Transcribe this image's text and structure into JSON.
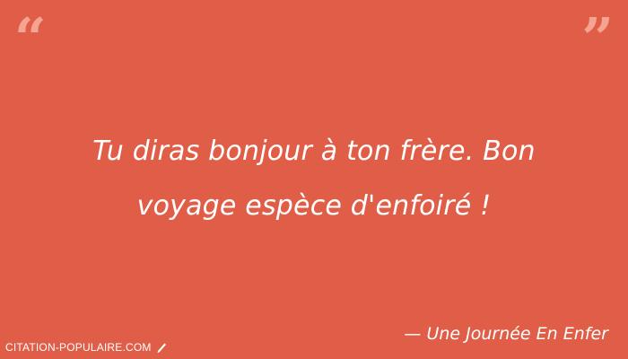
{
  "quote": {
    "open_mark": "“",
    "close_mark": "”",
    "line1": "Tu diras bonjour à ton frère. Bon",
    "line2": "voyage espèce d'enfoiré !"
  },
  "attribution": {
    "author": "— Une Journée En Enfer"
  },
  "footer": {
    "site_name": "CITATION-POPULAIRE.COM",
    "icon": "pen-icon"
  },
  "colors": {
    "background": "#e05d48",
    "quote_marks": "#f5a392",
    "text": "#ffffff"
  }
}
